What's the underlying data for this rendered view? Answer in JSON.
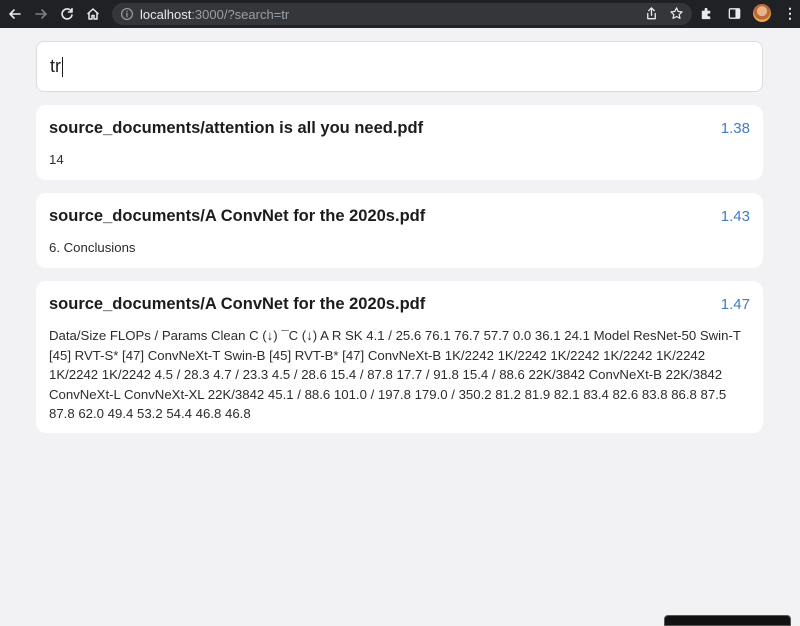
{
  "browser": {
    "url_host": "localhost",
    "url_path": ":3000/?search=tr"
  },
  "search": {
    "value": "tr"
  },
  "results": [
    {
      "title": "source_documents/attention is all you need.pdf",
      "score": "1.38",
      "snippet": "14"
    },
    {
      "title": "source_documents/A ConvNet for the 2020s.pdf",
      "score": "1.43",
      "snippet": "6. Conclusions"
    },
    {
      "title": "source_documents/A ConvNet for the 2020s.pdf",
      "score": "1.47",
      "snippet": "Data/Size FLOPs / Params Clean C (↓) ¯C (↓) A R SK 4.1 / 25.6 76.1 76.7 57.7 0.0 36.1 24.1 Model ResNet-50 Swin-T [45] RVT-S* [47] ConvNeXt-T Swin-B [45] RVT-B* [47] ConvNeXt-B 1K/2242 1K/2242 1K/2242 1K/2242 1K/2242 1K/2242 1K/2242 4.5 / 28.3 4.7 / 23.3 4.5 / 28.6 15.4 / 87.8 17.7 / 91.8 15.4 / 88.6 22K/3842 ConvNeXt-B 22K/3842 ConvNeXt-L ConvNeXt-XL 22K/3842 45.1 / 88.6 101.0 / 197.8 179.0 / 350.2 81.2 81.9 82.1 83.4 82.6 83.8 86.8 87.5 87.8 62.0 49.4 53.2 54.4 46.8 46.8"
    }
  ],
  "colors": {
    "score": "#3f7dc4",
    "page_bg": "#f2f2f4",
    "chrome_bg": "#202124"
  }
}
